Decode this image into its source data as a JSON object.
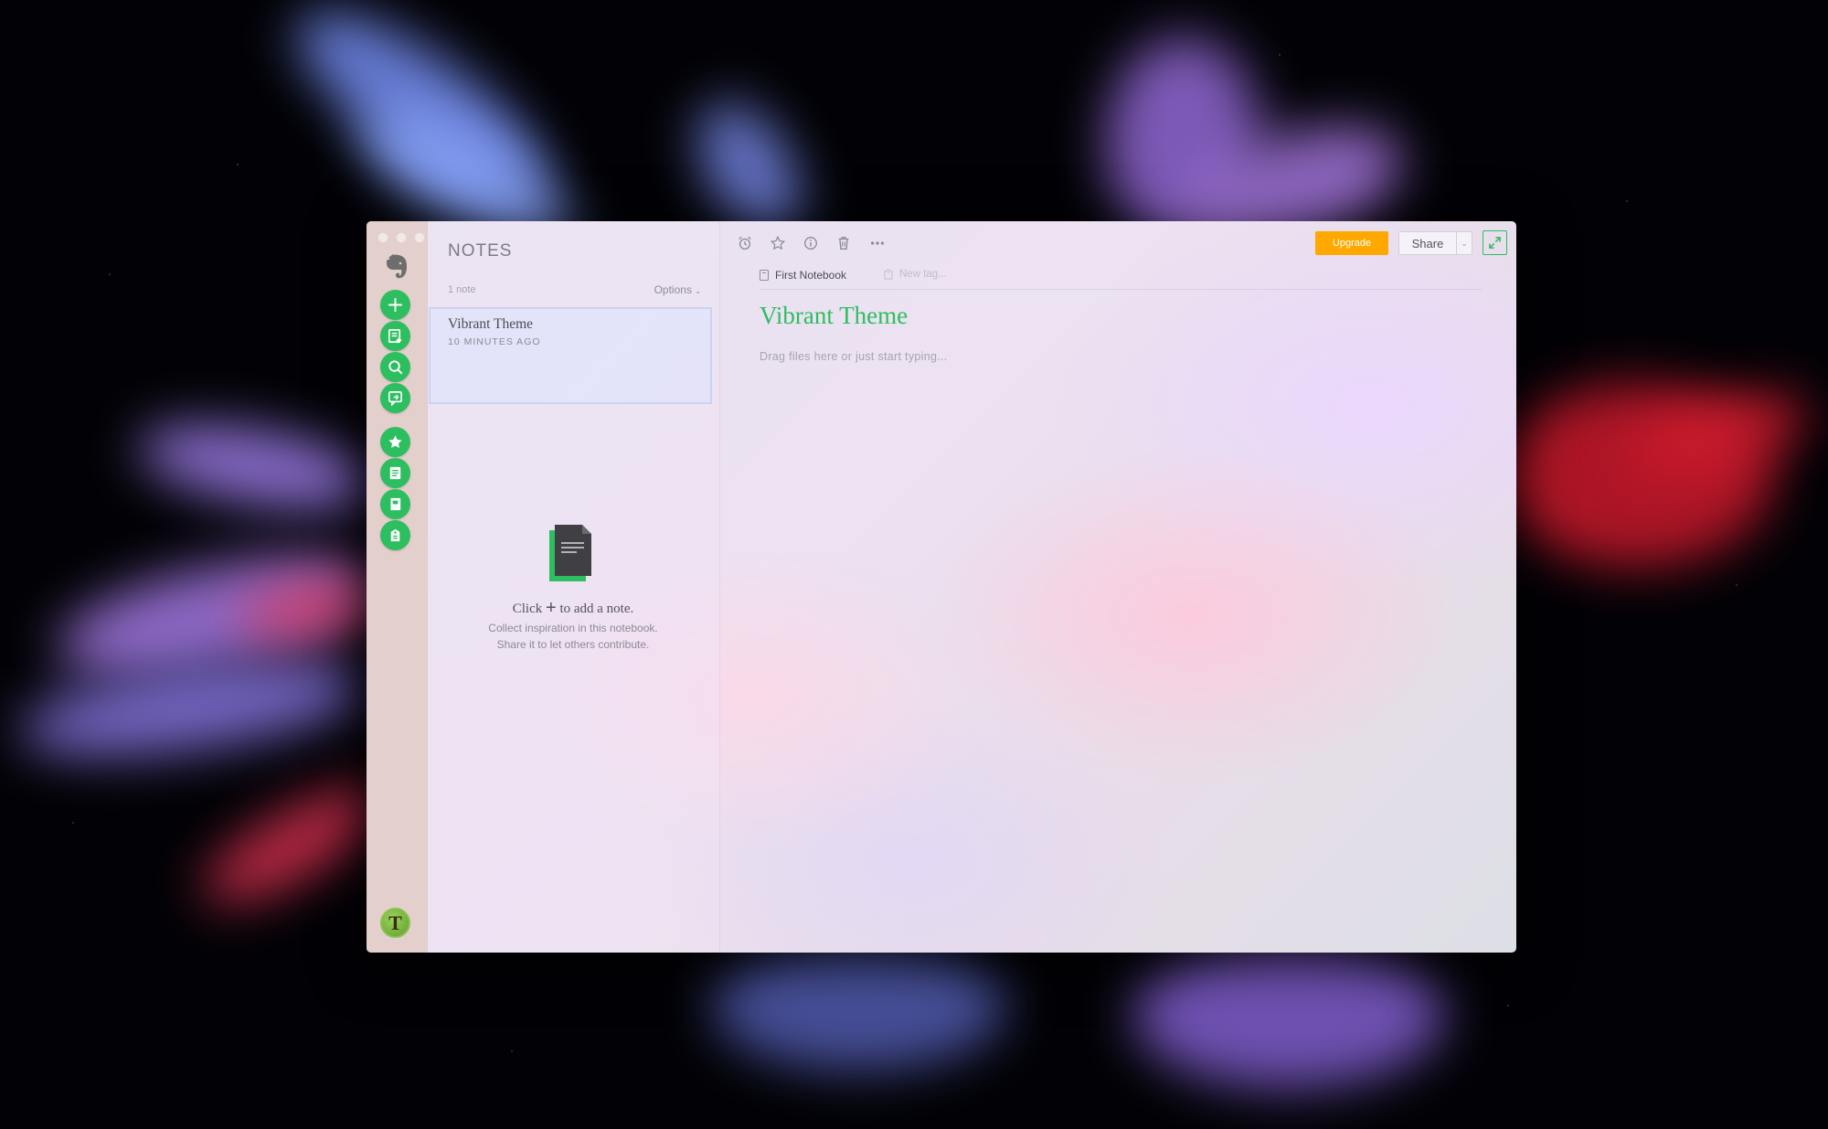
{
  "notes_list": {
    "title": "NOTES",
    "count": "1 note",
    "options": "Options",
    "notes": [
      {
        "title": "Vibrant Theme",
        "time": "10 MINUTES AGO"
      }
    ],
    "empty_state": {
      "click_prefix": "Click",
      "click_suffix": "to add a note.",
      "line1": "Collect inspiration in this notebook.",
      "line2": "Share it to let others contribute."
    }
  },
  "toolbar": {
    "upgrade": "Upgrade",
    "share": "Share"
  },
  "note": {
    "notebook": "First Notebook",
    "tag_placeholder": "New tag...",
    "title": "Vibrant Theme",
    "body_placeholder": "Drag files here or just start typing..."
  },
  "user": {
    "avatar_initial": "T"
  },
  "colors": {
    "accent_green": "#2dbe60",
    "upgrade_orange": "#ffa800"
  }
}
